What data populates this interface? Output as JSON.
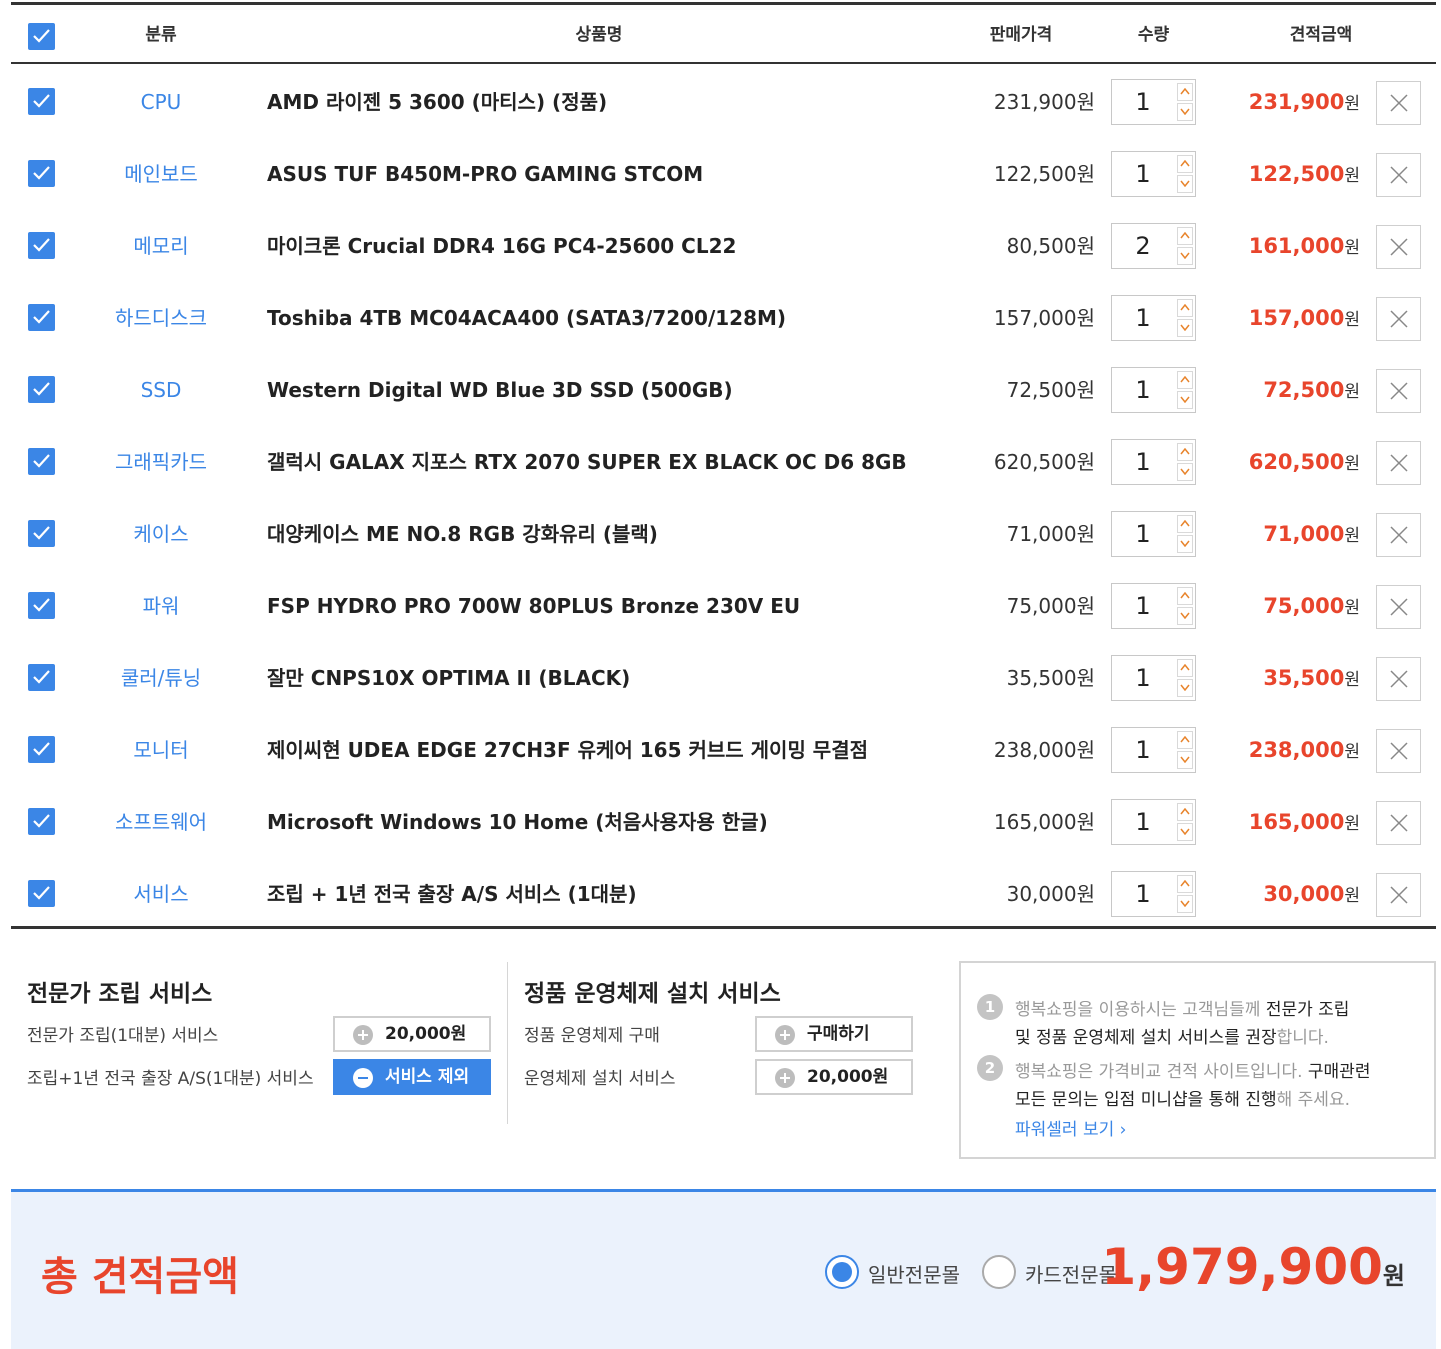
{
  "header": {
    "category": "분류",
    "product": "상품명",
    "price": "판매가격",
    "qty": "수량",
    "total": "견적금액"
  },
  "items": [
    {
      "category": "CPU",
      "name": "AMD 라이젠 5 3600 (마티스) (정품)",
      "price": "231,900원",
      "qty": "1",
      "total": "231,900",
      "won": "원"
    },
    {
      "category": "메인보드",
      "name": "ASUS TUF B450M-PRO GAMING STCOM",
      "price": "122,500원",
      "qty": "1",
      "total": "122,500",
      "won": "원"
    },
    {
      "category": "메모리",
      "name": "마이크론 Crucial DDR4 16G PC4-25600 CL22",
      "price": "80,500원",
      "qty": "2",
      "total": "161,000",
      "won": "원"
    },
    {
      "category": "하드디스크",
      "name": "Toshiba 4TB MC04ACA400 (SATA3/7200/128M)",
      "price": "157,000원",
      "qty": "1",
      "total": "157,000",
      "won": "원"
    },
    {
      "category": "SSD",
      "name": "Western Digital WD Blue 3D SSD (500GB)",
      "price": "72,500원",
      "qty": "1",
      "total": "72,500",
      "won": "원"
    },
    {
      "category": "그래픽카드",
      "name": "갤럭시 GALAX 지포스 RTX 2070 SUPER EX BLACK OC D6 8GB",
      "price": "620,500원",
      "qty": "1",
      "total": "620,500",
      "won": "원"
    },
    {
      "category": "케이스",
      "name": "대양케이스 ME NO.8 RGB 강화유리 (블랙)",
      "price": "71,000원",
      "qty": "1",
      "total": "71,000",
      "won": "원"
    },
    {
      "category": "파워",
      "name": "FSP HYDRO PRO 700W 80PLUS Bronze 230V EU",
      "price": "75,000원",
      "qty": "1",
      "total": "75,000",
      "won": "원"
    },
    {
      "category": "쿨러/튜닝",
      "name": "잘만 CNPS10X OPTIMA II (BLACK)",
      "price": "35,500원",
      "qty": "1",
      "total": "35,500",
      "won": "원"
    },
    {
      "category": "모니터",
      "name": "제이씨현 UDEA EDGE 27CH3F 유케어 165 커브드 게이밍 무결점",
      "price": "238,000원",
      "qty": "1",
      "total": "238,000",
      "won": "원"
    },
    {
      "category": "소프트웨어",
      "name": "Microsoft Windows 10 Home (처음사용자용 한글)",
      "price": "165,000원",
      "qty": "1",
      "total": "165,000",
      "won": "원"
    },
    {
      "category": "서비스",
      "name": "조립 + 1년 전국 출장 A/S 서비스 (1대분)",
      "price": "30,000원",
      "qty": "1",
      "total": "30,000",
      "won": "원"
    }
  ],
  "assembly": {
    "title": "전문가 조립 서비스",
    "row1_label": "전문가 조립(1대분) 서비스",
    "row1_btn": "20,000원",
    "row2_label": "조립+1년 전국 출장 A/S(1대분) 서비스",
    "row2_btn": "서비스 제외"
  },
  "os": {
    "title": "정품 운영체제 설치 서비스",
    "row1_label": "정품 운영체제 구매",
    "row1_btn": "구매하기",
    "row2_label": "운영체제 설치 서비스",
    "row2_btn": "20,000원"
  },
  "notice": {
    "n1": "1",
    "n1_a": "행복쇼핑을 이용하시는 고객님들께 ",
    "n1_b": "전문가 조립",
    "n1_c": "및 정품 운영체제 설치 서비스를 권장",
    "n1_d": "합니다.",
    "n2": "2",
    "n2_a": "행복쇼핑은 가격비교 견적 사이트입니다. ",
    "n2_b": "구매관련",
    "n2_c": "모든 문의는 입점 미니샵을 통해 진행",
    "n2_d": "해 주세요.",
    "link": "파워셀러 보기"
  },
  "summary": {
    "title": "총 견적금액",
    "radio1": "일반전문몰",
    "radio2": "카드전문몰",
    "selected": "일반전문몰",
    "amount": "1,979,900",
    "won": "원"
  },
  "colors": {
    "accent": "#3b86e6",
    "price_red": "#e8452c",
    "summary_bg": "#ebf2fc"
  }
}
